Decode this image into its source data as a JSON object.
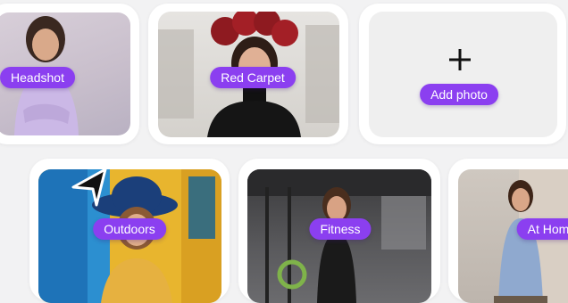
{
  "photos": {
    "headshot": {
      "label": "Headshot"
    },
    "red_carpet": {
      "label": "Red Carpet"
    },
    "outdoors": {
      "label": "Outdoors"
    },
    "fitness": {
      "label": "Fitness"
    },
    "at_home": {
      "label": "At Hom"
    }
  },
  "add_photo": {
    "label": "Add photo",
    "icon": "plus-icon"
  },
  "colors": {
    "accent": "#8b3ff0",
    "page_bg": "#f2f2f3",
    "card_bg": "#ffffff"
  }
}
